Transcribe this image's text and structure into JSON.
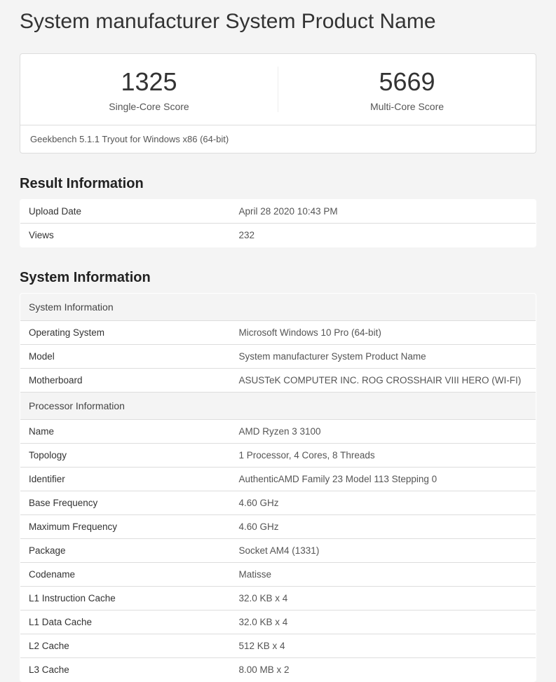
{
  "title": "System manufacturer System Product Name",
  "scores": {
    "single": {
      "value": "1325",
      "label": "Single-Core Score"
    },
    "multi": {
      "value": "5669",
      "label": "Multi-Core Score"
    }
  },
  "version_line": "Geekbench 5.1.1 Tryout for Windows x86 (64-bit)",
  "result_info": {
    "heading": "Result Information",
    "rows": [
      {
        "key": "Upload Date",
        "val": "April 28 2020 10:43 PM"
      },
      {
        "key": "Views",
        "val": "232"
      }
    ]
  },
  "system_info": {
    "heading": "System Information",
    "group1_title": "System Information",
    "group1_rows": [
      {
        "key": "Operating System",
        "val": "Microsoft Windows 10 Pro (64-bit)"
      },
      {
        "key": "Model",
        "val": "System manufacturer System Product Name"
      },
      {
        "key": "Motherboard",
        "val": "ASUSTeK COMPUTER INC. ROG CROSSHAIR VIII HERO (WI-FI)"
      }
    ],
    "group2_title": "Processor Information",
    "group2_rows": [
      {
        "key": "Name",
        "val": "AMD Ryzen 3 3100"
      },
      {
        "key": "Topology",
        "val": "1 Processor, 4 Cores, 8 Threads"
      },
      {
        "key": "Identifier",
        "val": "AuthenticAMD Family 23 Model 113 Stepping 0"
      },
      {
        "key": "Base Frequency",
        "val": "4.60 GHz"
      },
      {
        "key": "Maximum Frequency",
        "val": "4.60 GHz"
      },
      {
        "key": "Package",
        "val": "Socket AM4 (1331)"
      },
      {
        "key": "Codename",
        "val": "Matisse"
      },
      {
        "key": "L1 Instruction Cache",
        "val": "32.0 KB x 4"
      },
      {
        "key": "L1 Data Cache",
        "val": "32.0 KB x 4"
      },
      {
        "key": "L2 Cache",
        "val": "512 KB x 4"
      },
      {
        "key": "L3 Cache",
        "val": "8.00 MB x 2"
      }
    ]
  }
}
